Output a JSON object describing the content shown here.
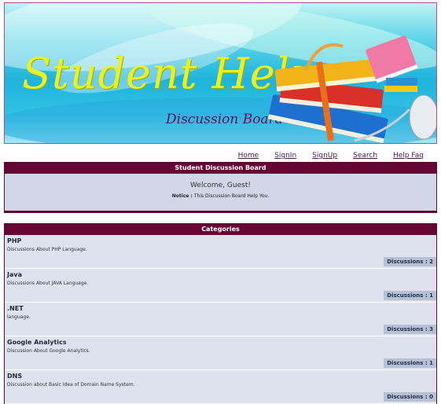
{
  "banner": {
    "title": "Student Help",
    "subtitle": "Discussion Board"
  },
  "nav": {
    "items": [
      "Home",
      "SignIn",
      "SignUp",
      "Search",
      "Help Faq"
    ]
  },
  "board": {
    "header": "Student Discussion Board",
    "welcome": "Welcome, Guest!",
    "notice_label": "Notice :",
    "notice_text": "This Discussion Board Help You."
  },
  "categories": {
    "header": "Categories",
    "items": [
      {
        "name": "PHP",
        "description": "Discussions About PHP Language.",
        "badge": "Discussions : 2"
      },
      {
        "name": "Java",
        "description": "Discussions About JAVA Language.",
        "badge": "Discussions : 1"
      },
      {
        "name": ".NET",
        "description": "language.",
        "badge": "Discussions : 3"
      },
      {
        "name": "Google Analytics",
        "description": "Discussion About Google Analytics.",
        "badge": "Discussions : 1"
      },
      {
        "name": "DNS",
        "description": "Discussion about Basic Idea of Domain Name System.",
        "badge": "Discussions : 0"
      }
    ]
  },
  "colors": {
    "header_bg": "#650634",
    "panel_bg": "#d1d7e6",
    "badge_bg": "#b7c1d6",
    "title_color": "#e7f02a"
  }
}
